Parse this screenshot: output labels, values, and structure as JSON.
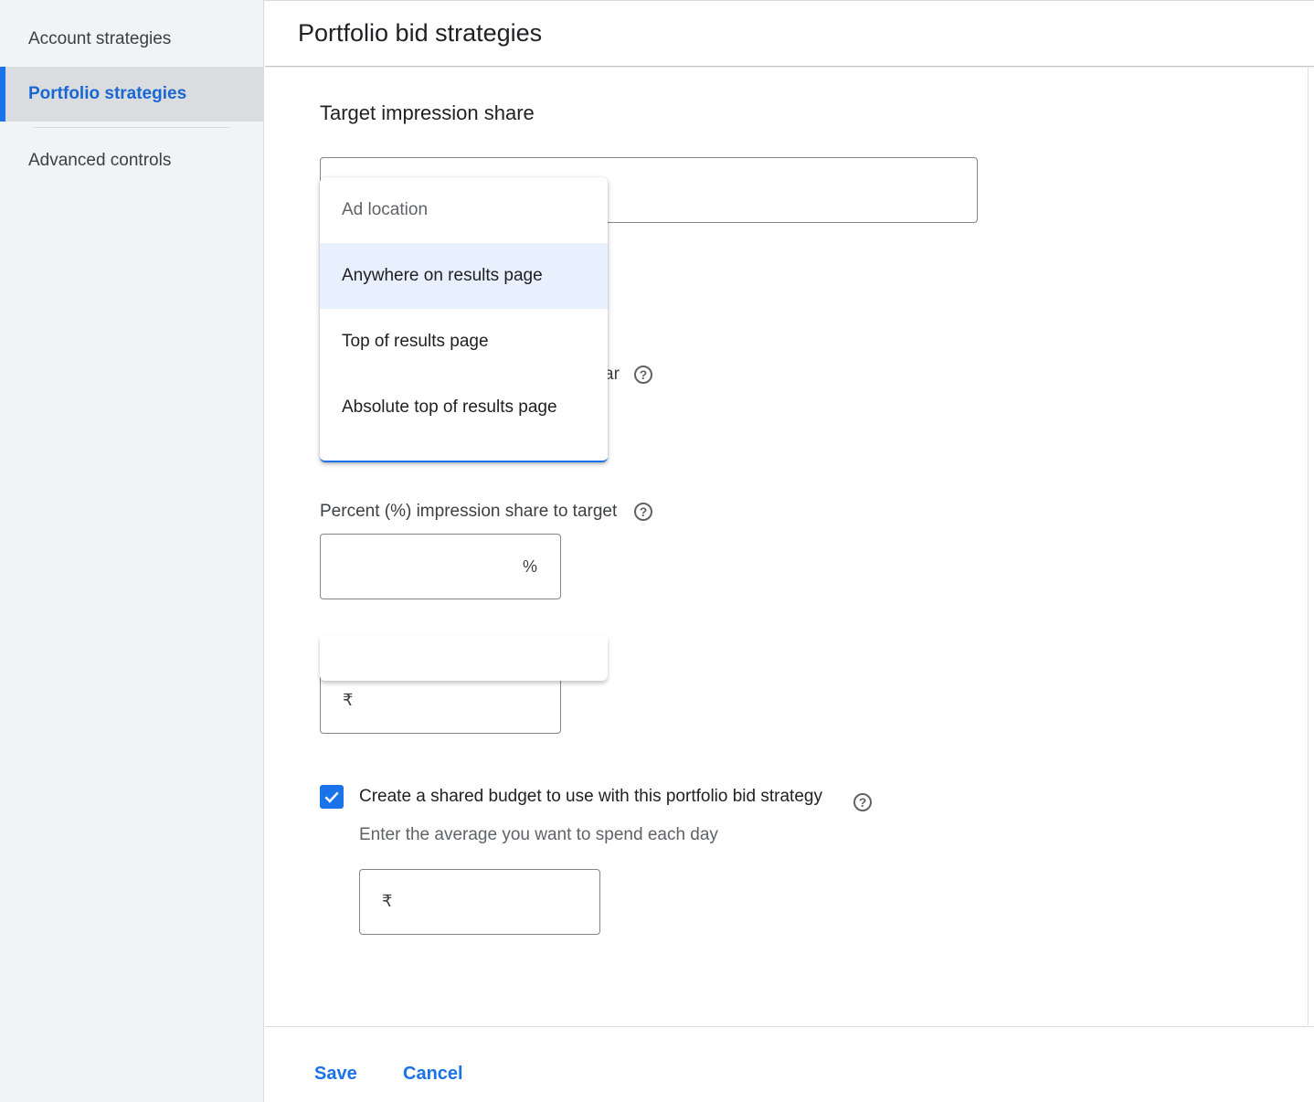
{
  "sidebar": {
    "items": [
      {
        "label": "Account strategies",
        "active": false
      },
      {
        "label": "Portfolio strategies",
        "active": true
      },
      {
        "label": "Advanced controls",
        "active": false
      }
    ]
  },
  "header": {
    "title": "Portfolio bid strategies"
  },
  "form": {
    "section_title": "Target impression share",
    "partial_label_tail": "ar",
    "percent_label": "Percent (%) impression share to target",
    "percent_suffix": "%",
    "percent_value": "",
    "bid_limit_currency": "₹",
    "bid_limit_value": "",
    "shared_budget_checkbox": {
      "label": "Create a shared budget to use with this portfolio bid strategy",
      "checked": true
    },
    "shared_budget_hint": "Enter the average you want to spend each day",
    "budget_currency": "₹",
    "budget_value": ""
  },
  "dropdown": {
    "header": "Ad location",
    "options": [
      {
        "label": "Anywhere on results page",
        "selected": true
      },
      {
        "label": "Top of results page",
        "selected": false
      },
      {
        "label": "Absolute top of results page",
        "selected": false
      }
    ]
  },
  "footer": {
    "save_label": "Save",
    "cancel_label": "Cancel"
  },
  "colors": {
    "accent": "#1a73e8",
    "selected_bg": "#e8f0fe",
    "sidebar_bg": "#f1f3f4"
  }
}
